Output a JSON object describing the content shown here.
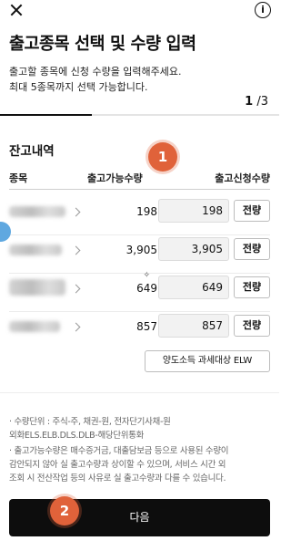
{
  "header": {
    "title": "출고종목 선택 및 수량 입력",
    "description_lines": [
      "출고할 종목에 신청 수량을 입력해주세요.",
      "최대 5종목까지 선택 가능합니다."
    ],
    "step_current": "1",
    "step_total": "/3",
    "progress": 0.33,
    "info_icon": "i"
  },
  "holdings": {
    "section_title": "잔고내역",
    "columns": {
      "name": "종목",
      "available": "출고가능수량",
      "request": "출고신청수량"
    },
    "rows": [
      {
        "available": "198",
        "request": "198",
        "all_label": "전량"
      },
      {
        "available": "3,905",
        "request": "3,905",
        "all_label": "전량"
      },
      {
        "available": "649",
        "request": "649",
        "all_label": "전량"
      },
      {
        "available": "857",
        "request": "857",
        "all_label": "전량"
      }
    ]
  },
  "tax_button": "양도소득 과세대상 ELW",
  "notes": [
    "· 수량단위 : 주식-주, 채권-원, 전자단기사채-원",
    "  외화ELS.ELB.DLS.DLB-해당단위통화",
    "· 출고가능수량은 매수증거금, 대출담보금 등으로 사용된 수량이",
    "  감안되지 않아 실 출고수량과 상이할 수 있으며, 서비스 시간 외",
    "  조회 시 전산작업 등의 사유로 실 출고수량과 다를 수 있습니다."
  ],
  "annotations": {
    "badge1": "1",
    "badge2": "2"
  },
  "next_button": "다음",
  "colors": {
    "badge": "#e0623a",
    "primary_button": "#0d0d0d",
    "side_marker": "#5fa8e0"
  }
}
